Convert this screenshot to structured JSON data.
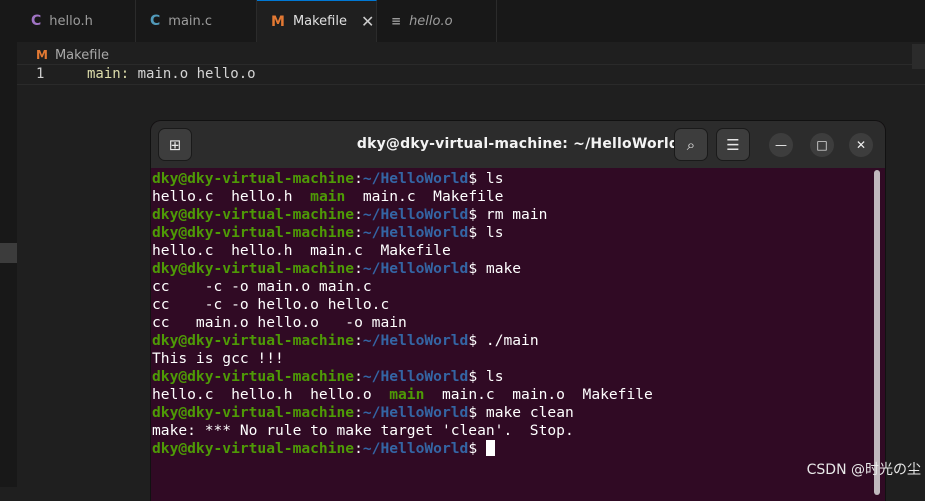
{
  "editor": {
    "tabs": [
      {
        "label": "hello.h",
        "icon": "C",
        "icon_name": "c-file-icon",
        "italic": false,
        "active": false
      },
      {
        "label": "main.c",
        "icon": "C",
        "icon_name": "c-file-icon",
        "italic": false,
        "active": false
      },
      {
        "label": "Makefile",
        "icon": "M",
        "icon_name": "makefile-icon",
        "italic": false,
        "active": true,
        "close": "✕"
      },
      {
        "label": "hello.o",
        "icon": "≡",
        "icon_name": "text-file-icon",
        "italic": true,
        "active": false
      }
    ],
    "breadcrumb": {
      "icon": "M",
      "label": "Makefile"
    },
    "lines": [
      {
        "number": "1",
        "target": "main:",
        "rest": " main.o hello.o"
      }
    ]
  },
  "terminal": {
    "title": "dky@dky-virtual-machine: ~/HelloWorld",
    "buttons": {
      "new_tab": "⊞",
      "search": "⌕",
      "menu": "☰",
      "minimize": "—",
      "maximize": "□",
      "close": "✕"
    },
    "prompt_user": "dky@dky-virtual-machine",
    "prompt_sep": ":",
    "prompt_path": "~/HelloWorld",
    "prompt_end": "$",
    "lines": [
      {
        "type": "cmd",
        "text": " ls"
      },
      {
        "type": "out",
        "parts": [
          "hello.c  hello.h  ",
          {
            "g": "main"
          },
          "  main.c  Makefile"
        ]
      },
      {
        "type": "cmd",
        "text": " rm main"
      },
      {
        "type": "cmd",
        "text": " ls"
      },
      {
        "type": "out",
        "parts": [
          "hello.c  hello.h  main.c  Makefile"
        ]
      },
      {
        "type": "cmd",
        "text": " make"
      },
      {
        "type": "out",
        "parts": [
          "cc    -c -o main.o main.c"
        ]
      },
      {
        "type": "out",
        "parts": [
          "cc    -c -o hello.o hello.c"
        ]
      },
      {
        "type": "out",
        "parts": [
          "cc   main.o hello.o   -o main"
        ]
      },
      {
        "type": "cmd",
        "text": " ./main"
      },
      {
        "type": "out",
        "parts": [
          "This is gcc !!!"
        ]
      },
      {
        "type": "cmd",
        "text": " ls"
      },
      {
        "type": "out",
        "parts": [
          "hello.c  hello.h  hello.o  ",
          {
            "g": "main"
          },
          "  main.c  main.o  Makefile"
        ]
      },
      {
        "type": "cmd",
        "text": " make clean"
      },
      {
        "type": "out",
        "parts": [
          "make: *** No rule to make target 'clean'.  Stop."
        ]
      },
      {
        "type": "cmd",
        "text": " ",
        "cursor": true
      }
    ]
  },
  "watermark": "CSDN @时光の尘",
  "colors": {
    "prompt_user": "#4e9a06",
    "prompt_path": "#3465a4",
    "terminal_bg": "#300a24",
    "active_tab_border": "#0078d4"
  }
}
